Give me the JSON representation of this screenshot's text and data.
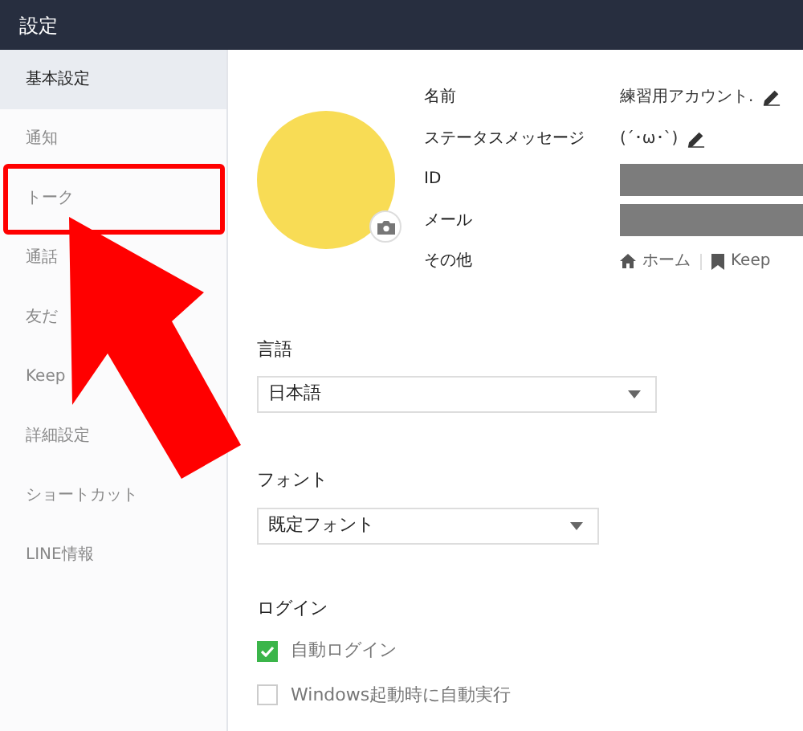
{
  "window": {
    "title": "設定"
  },
  "sidebar": {
    "items": [
      {
        "label": "基本設定",
        "selected": true
      },
      {
        "label": "通知",
        "selected": false
      },
      {
        "label": "トーク",
        "selected": false
      },
      {
        "label": "通話",
        "selected": false
      },
      {
        "label": "友だ",
        "selected": false
      },
      {
        "label": "Keep",
        "selected": false
      },
      {
        "label": "詳細設定",
        "selected": false
      },
      {
        "label": "ショートカット",
        "selected": false
      },
      {
        "label": "LINE情報",
        "selected": false
      }
    ]
  },
  "profile": {
    "rows": [
      {
        "label": "名前",
        "kind": "text",
        "value": "練習用アカウント.",
        "editable": true
      },
      {
        "label": "ステータスメッセージ",
        "kind": "text",
        "value": "(´･ω･`)",
        "editable": true
      },
      {
        "label": "ID",
        "kind": "redacted"
      },
      {
        "label": "メール",
        "kind": "redacted"
      },
      {
        "label": "その他",
        "kind": "links",
        "links": [
          "ホーム",
          "Keep"
        ]
      }
    ]
  },
  "language": {
    "label": "言語",
    "value": "日本語"
  },
  "font": {
    "label": "フォント",
    "value": "既定フォント"
  },
  "login": {
    "label": "ログイン",
    "options": [
      {
        "label": "自動ログイン",
        "checked": true
      },
      {
        "label": "Windows起動時に自動実行",
        "checked": false
      }
    ]
  }
}
